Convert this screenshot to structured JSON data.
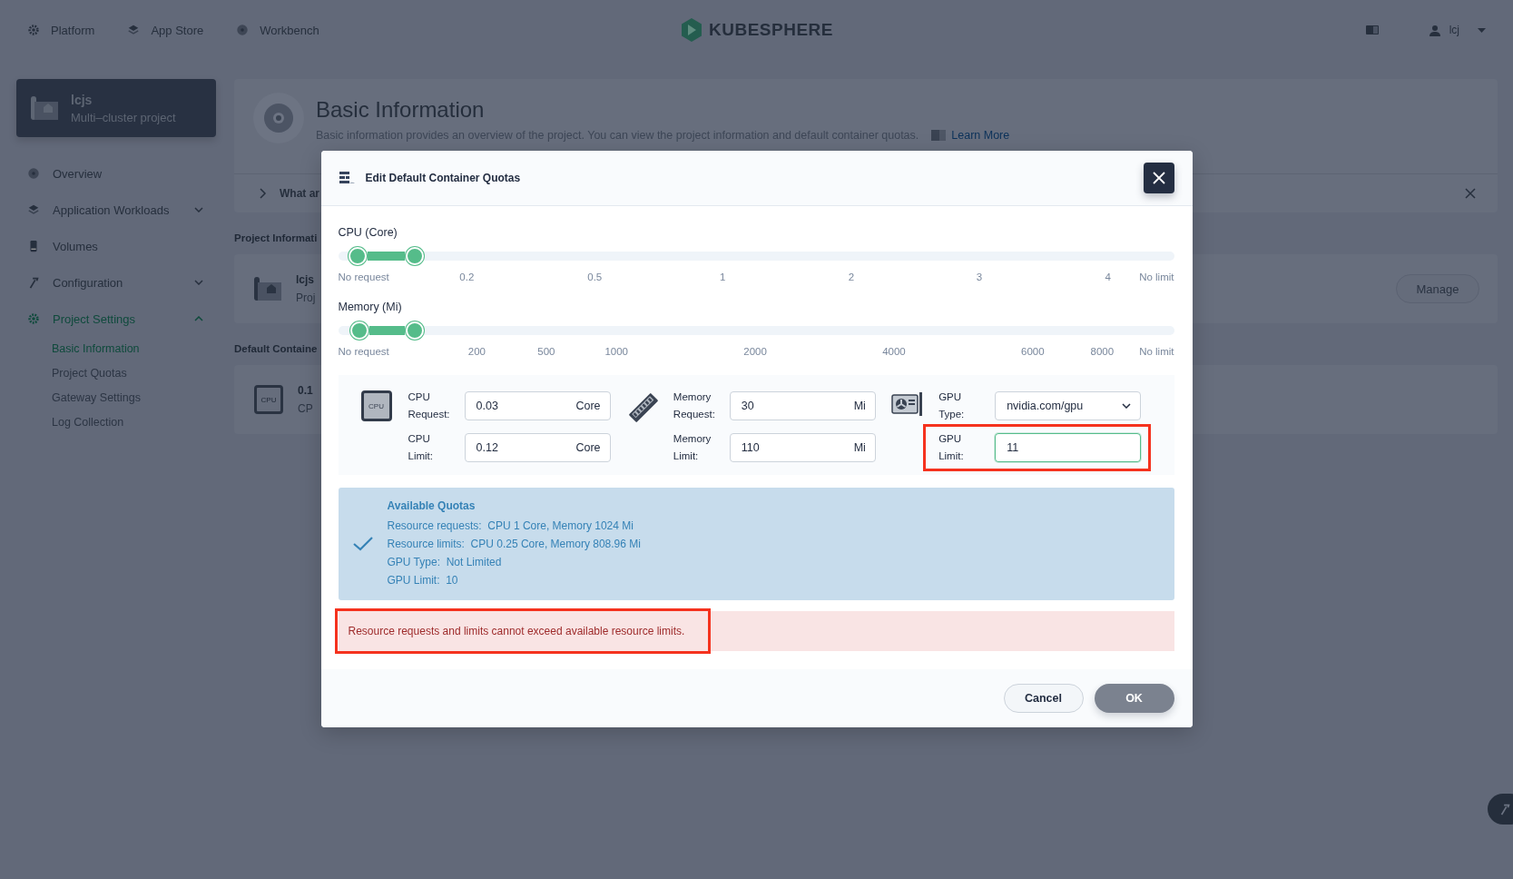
{
  "top_nav": {
    "items": [
      {
        "label": "Platform"
      },
      {
        "label": "App Store"
      },
      {
        "label": "Workbench"
      }
    ],
    "logo": "KUBESPHERE",
    "user": "lcj"
  },
  "sidebar": {
    "project": {
      "name": "lcjs",
      "subtitle": "Multi–cluster project"
    },
    "items": [
      {
        "label": "Overview",
        "kind": "link",
        "selected": false
      },
      {
        "label": "Application Workloads",
        "kind": "group",
        "expanded": false,
        "selected": false
      },
      {
        "label": "Volumes",
        "kind": "link",
        "selected": false
      },
      {
        "label": "Configuration",
        "kind": "group",
        "expanded": false,
        "selected": false
      },
      {
        "label": "Project Settings",
        "kind": "group",
        "expanded": true,
        "selected": true,
        "children": [
          {
            "label": "Basic Information",
            "selected": true
          },
          {
            "label": "Project Quotas",
            "selected": false
          },
          {
            "label": "Gateway Settings",
            "selected": false
          },
          {
            "label": "Log Collection",
            "selected": false
          }
        ]
      }
    ]
  },
  "page": {
    "title": "Basic Information",
    "description": "Basic information provides an overview of the project. You can view the project information and default container quotas.",
    "learn_more": "Learn More",
    "tip": "What ar",
    "project_info": {
      "heading": "Project Informati",
      "name": "lcjs",
      "subtitle": "Proj",
      "button": "Manage"
    },
    "default_quotas": {
      "heading": "Default Containe",
      "icon_label": "CPU",
      "value": "0.1",
      "label": "CP"
    }
  },
  "dialog": {
    "title": "Edit Default Container Quotas",
    "sliders": [
      {
        "label": "CPU (Core)",
        "marks": [
          "No request",
          "0.2",
          "0.5",
          "1",
          "2",
          "3",
          "4",
          "No limit"
        ],
        "thumbs": [
          {
            "level": 0.023
          },
          {
            "level": 0.092
          }
        ]
      },
      {
        "label": "Memory (Mi)",
        "marks": [
          "No request",
          "200",
          "500",
          "1000",
          "2000",
          "4000",
          "6000",
          "8000",
          "No limit"
        ],
        "thumbs": [
          {
            "level": 0.025
          },
          {
            "level": 0.092
          }
        ]
      }
    ],
    "groups": [
      {
        "kind": "cpu",
        "icon_label": "CPU",
        "rows": [
          {
            "label": "CPU Request:",
            "kind": "input",
            "value": "0.03",
            "unit": "Core",
            "focused": false,
            "highlighted": false
          },
          {
            "label": "CPU Limit:",
            "kind": "input",
            "value": "0.12",
            "unit": "Core",
            "focused": false,
            "highlighted": false
          }
        ]
      },
      {
        "kind": "memory",
        "rows": [
          {
            "label": "Memory Request:",
            "kind": "input",
            "value": "30",
            "unit": "Mi",
            "focused": false,
            "highlighted": false
          },
          {
            "label": "Memory Limit:",
            "kind": "input",
            "value": "110",
            "unit": "Mi",
            "focused": false,
            "highlighted": false
          }
        ]
      },
      {
        "kind": "gpu",
        "rows": [
          {
            "label": "GPU Type:",
            "kind": "select",
            "value": "nvidia.com/gpu",
            "focused": false,
            "highlighted": false
          },
          {
            "label": "GPU Limit:",
            "kind": "input",
            "value": "11",
            "focused": true,
            "highlighted": true
          }
        ]
      }
    ],
    "quotas": {
      "title": "Available Quotas",
      "items": [
        {
          "label": "Resource requests:",
          "value": "CPU 1 Core, Memory 1024 Mi"
        },
        {
          "label": "Resource limits:",
          "value": "CPU 0.25 Core, Memory 808.96 Mi"
        },
        {
          "label": "GPU Type:",
          "value": "Not Limited"
        },
        {
          "label": "GPU Limit:",
          "value": "10"
        }
      ]
    },
    "error": {
      "message": "Resource requests and limits cannot exceed available resource limits.",
      "highlighted": true
    },
    "buttons": [
      {
        "label": "Cancel",
        "kind": "secondary",
        "disabled": false
      },
      {
        "label": "OK",
        "kind": "primary",
        "disabled": true
      }
    ]
  }
}
